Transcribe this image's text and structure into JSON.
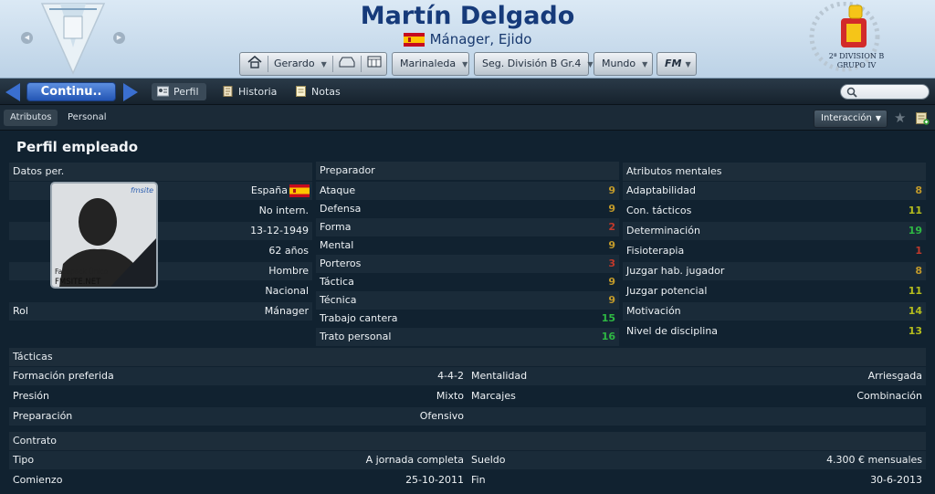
{
  "header": {
    "manager_name": "Martín Delgado",
    "subtitle": "Mánager, Ejido",
    "toolbar": {
      "manager_menu": "Gerardo",
      "team_menu": "Marinaleda",
      "league_menu": "Seg. División B Gr.4",
      "world_menu": "Mundo",
      "fm_menu": "FM"
    },
    "league_logo_text": [
      "2ª DIVISION B",
      "GRUPO IV"
    ]
  },
  "nav": {
    "continue_label": "Continu..",
    "tabs": [
      "Perfil",
      "Historia",
      "Notas"
    ],
    "search_placeholder": ""
  },
  "subnav": {
    "tabs": [
      "Atributos",
      "Personal"
    ],
    "interaction_label": "Interacción"
  },
  "page": {
    "title": "Perfil empleado",
    "personal": {
      "heading": "Datos per.",
      "nationality": "España",
      "intl_status": "No intern.",
      "birth_date": "13-12-1949",
      "age": "62 años",
      "gender": "Hombre",
      "level": "Nacional",
      "role_label": "Rol",
      "role_value": "Mánager",
      "photo_caption": [
        "Facepack Único",
        "FMSITE.NET"
      ]
    },
    "coach": {
      "heading": "Preparador",
      "attributes": [
        {
          "name": "Ataque",
          "value": "9"
        },
        {
          "name": "Defensa",
          "value": "9"
        },
        {
          "name": "Forma",
          "value": "2"
        },
        {
          "name": "Mental",
          "value": "9"
        },
        {
          "name": "Porteros",
          "value": "3"
        },
        {
          "name": "Táctica",
          "value": "9"
        },
        {
          "name": "Técnica",
          "value": "9"
        },
        {
          "name": "Trabajo cantera",
          "value": "15"
        },
        {
          "name": "Trato personal",
          "value": "16"
        }
      ]
    },
    "mental": {
      "heading": "Atributos mentales",
      "attributes": [
        {
          "name": "Adaptabilidad",
          "value": "8"
        },
        {
          "name": "Con. tácticos",
          "value": "11"
        },
        {
          "name": "Determinación",
          "value": "19"
        },
        {
          "name": "Fisioterapia",
          "value": "1"
        },
        {
          "name": "Juzgar hab. jugador",
          "value": "8"
        },
        {
          "name": "Juzgar potencial",
          "value": "11"
        },
        {
          "name": "Motivación",
          "value": "14"
        },
        {
          "name": "Nivel de disciplina",
          "value": "13"
        }
      ]
    },
    "tactics": {
      "heading": "Tácticas",
      "rows": [
        {
          "l1": "Formación preferida",
          "v1": "4-4-2",
          "l2": "Mentalidad",
          "v2": "Arriesgada"
        },
        {
          "l1": "Presión",
          "v1": "Mixto",
          "l2": "Marcajes",
          "v2": "Combinación"
        },
        {
          "l1": "Preparación",
          "v1": "Ofensivo",
          "l2": "",
          "v2": ""
        }
      ]
    },
    "contract": {
      "heading": "Contrato",
      "rows": [
        {
          "l1": "Tipo",
          "v1": "A jornada completa",
          "l2": "Sueldo",
          "v2": "4.300 € mensuales"
        },
        {
          "l1": "Comienzo",
          "v1": "25-10-2011",
          "l2": "Fin",
          "v2": "30-6-2013"
        }
      ]
    }
  },
  "colors": {
    "attr_low": "#c0392b",
    "attr_mid": "#c29a2a",
    "attr_good": "#b5bd1d",
    "attr_high": "#2eb843",
    "accent_blue": "#2a63c8"
  }
}
